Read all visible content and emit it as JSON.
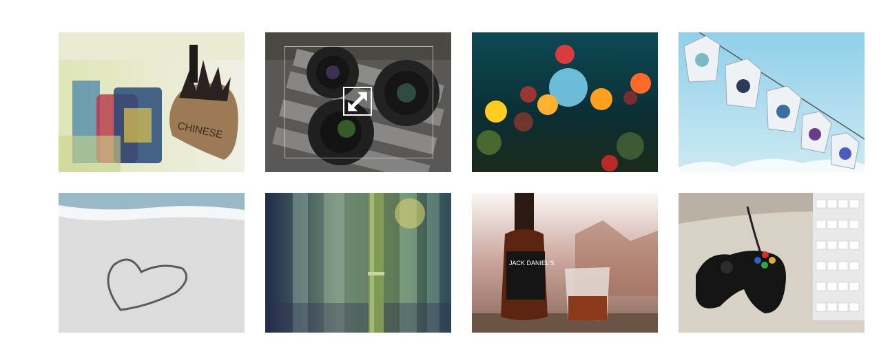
{
  "gallery": {
    "items": [
      {
        "subject": "burlap sack with pinecone",
        "text": "CHINESE"
      },
      {
        "subject": "camera lenses",
        "hovered": true
      },
      {
        "subject": "bokeh lights through rainy window"
      },
      {
        "subject": "t-shirts on a clothesline"
      },
      {
        "subject": "heart drawn in sand"
      },
      {
        "subject": "green bamboo stalk"
      },
      {
        "subject": "whiskey bottle and glass",
        "text": "JACK DANIEL'S"
      },
      {
        "subject": "game controller and keyboard"
      }
    ],
    "hover_icon": "expand-arrows-icon"
  },
  "colors": {
    "background": "#ffffff",
    "overlay": "rgba(30,30,30,0.45)"
  }
}
